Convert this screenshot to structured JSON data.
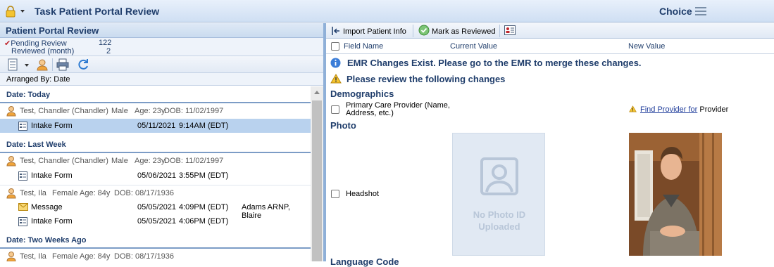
{
  "titlebar": {
    "title": "Task Patient Portal Review",
    "choice_label": "Choice"
  },
  "left": {
    "header": "Patient Portal Review",
    "stats": {
      "pending_label": "Pending Review",
      "pending_count": "122",
      "reviewed_label": "Reviewed (month)",
      "reviewed_count": "2"
    },
    "arranged": "Arranged By: Date",
    "groups": [
      {
        "label": "Date: Today"
      },
      {
        "label": "Date: Last Week"
      },
      {
        "label": "Date: Two Weeks Ago"
      }
    ],
    "patients": [
      {
        "name": "Test, Chandler (Chandler)",
        "sex": "Male",
        "age": "Age: 23y",
        "dob": "DOB: 11/02/1997"
      },
      {
        "name": "Test, Chandler (Chandler)",
        "sex": "Male",
        "age": "Age: 23y",
        "dob": "DOB: 11/02/1997"
      },
      {
        "name": "Test, Ila",
        "sex": "Female",
        "age": "Age: 84y",
        "dob": "DOB: 08/17/1936"
      },
      {
        "name": "Test, Ila",
        "sex": "Female",
        "age": "Age: 84y",
        "dob": "DOB: 08/17/1936"
      }
    ],
    "items": [
      {
        "label": "Intake Form",
        "date": "05/11/2021",
        "time": "9:14AM (EDT)",
        "provider": ""
      },
      {
        "label": "Intake Form",
        "date": "05/06/2021",
        "time": "3:55PM (EDT)",
        "provider": ""
      },
      {
        "label": "Message",
        "date": "05/05/2021",
        "time": "4:09PM (EDT)",
        "provider": "Adams ARNP, Blaire"
      },
      {
        "label": "Intake Form",
        "date": "05/05/2021",
        "time": "4:06PM (EDT)",
        "provider": ""
      }
    ]
  },
  "right": {
    "toolbar": {
      "import_label": "Import Patient Info",
      "mark_label": "Mark as Reviewed"
    },
    "columns": {
      "field": "Field Name",
      "current": "Current Value",
      "new": "New Value"
    },
    "emr_message": "EMR Changes Exist. Please go to the EMR to merge these changes.",
    "review_message": "Please review the following changes",
    "sections": {
      "demographics": "Demographics",
      "photo": "Photo",
      "next": "Language Code"
    },
    "pcp": {
      "field_line1": "Primary Care Provider (Name,",
      "field_line2": "Address, etc.)",
      "find_link": "Find Provider for",
      "find_suffix": "Provider"
    },
    "headshot": {
      "field": "Headshot",
      "no_photo_line1": "No Photo ID",
      "no_photo_line2": "Uploaded"
    }
  },
  "colors": {
    "accent": "#1f3d6b",
    "selection": "#b9d2ee",
    "divider": "#8fb0d8"
  }
}
